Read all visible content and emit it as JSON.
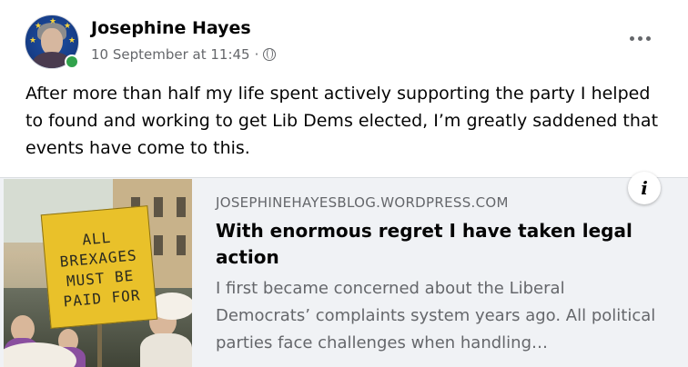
{
  "post": {
    "author": "Josephine Hayes",
    "timestamp": "10 September at 11:45",
    "separator": "·",
    "privacy_icon": "globe-icon",
    "body": "After more than half my life spent actively supporting the party I helped to found and working to get Lib Dems elected, I’m greatly saddened that events have come to this.",
    "online": true
  },
  "link_preview": {
    "domain": "JOSEPHINEHAYESBLOG.WORDPRESS.COM",
    "headline": "With enormous regret I have taken legal action",
    "excerpt": "I first became concerned about the Liberal Democrats’ complaints system years ago. All political parties face challenges when handling…",
    "image_sign_lines": [
      "ALL",
      "BREXAGES",
      "MUST BE",
      "PAID FOR"
    ],
    "info_icon": "info-icon"
  },
  "colors": {
    "text_primary": "#050505",
    "text_secondary": "#65676b",
    "preview_bg": "#f0f2f5",
    "online_green": "#31a24c"
  }
}
